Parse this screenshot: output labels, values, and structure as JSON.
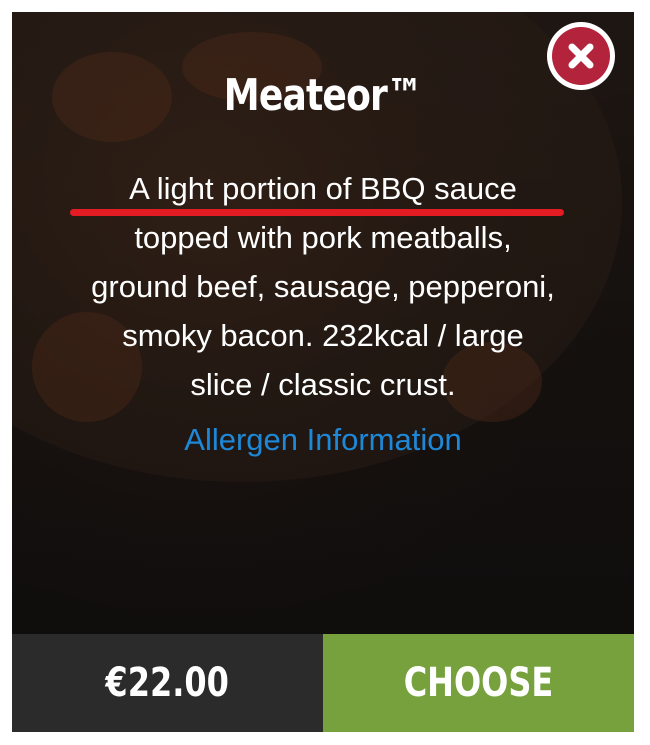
{
  "product": {
    "title": "Meateor™",
    "description_lines": [
      "A light portion of BBQ sauce",
      "topped with pork meatballs,",
      "ground beef, sausage, pepperoni,",
      "smoky bacon. 232kcal / large",
      "slice / classic crust."
    ],
    "allergen_link": "Allergen Information"
  },
  "footer": {
    "price": "€22.00",
    "choose_label": "CHOOSE"
  },
  "colors": {
    "close_button": "#b3233b",
    "underline": "#e31b23",
    "link": "#1e88d8",
    "price_bg": "#2b2b2b",
    "choose_bg": "#76a13c"
  },
  "icons": {
    "close": "close-icon"
  }
}
